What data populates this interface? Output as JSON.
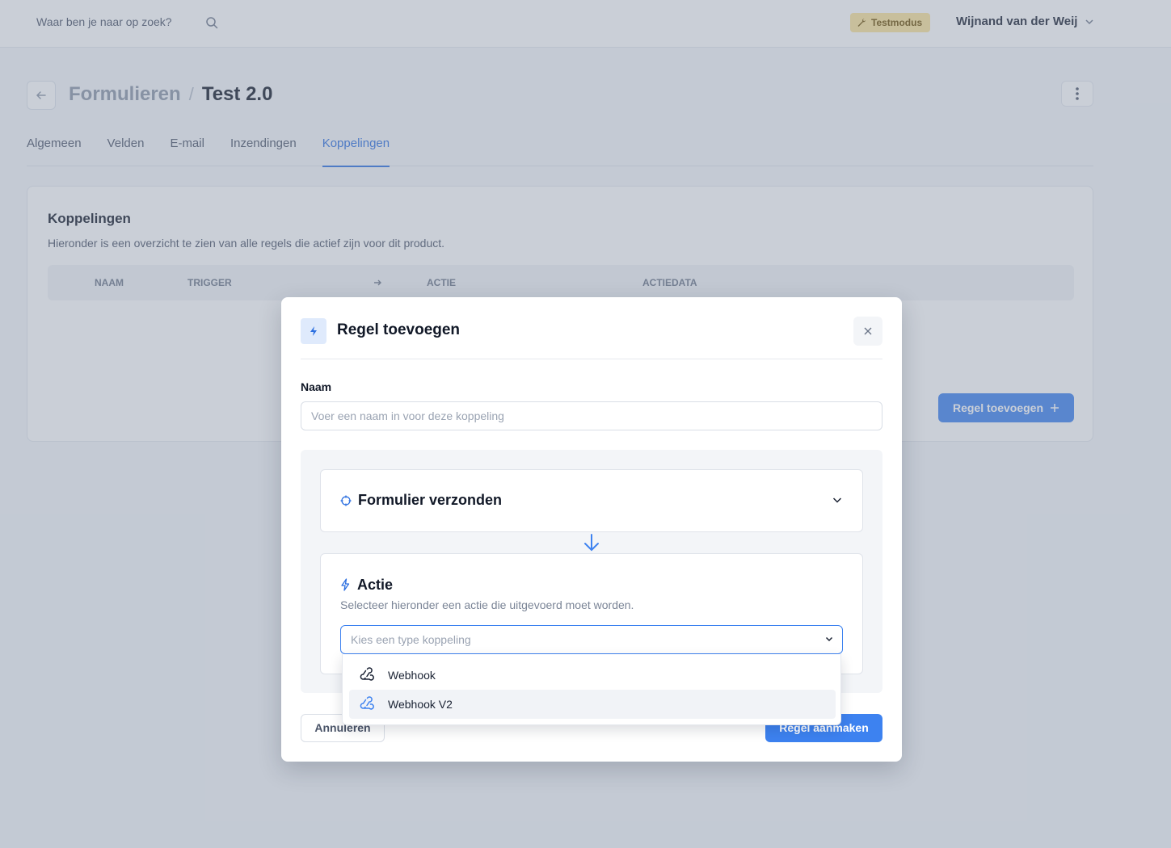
{
  "topbar": {
    "search_placeholder": "Waar ben je naar op zoek?",
    "badge": "Testmodus",
    "user_name": "Wijnand van der Weij"
  },
  "header": {
    "breadcrumb_parent": "Formulieren",
    "breadcrumb_sep": "/",
    "breadcrumb_current": "Test 2.0"
  },
  "tabs": [
    "Algemeen",
    "Velden",
    "E-mail",
    "Inzendingen",
    "Koppelingen"
  ],
  "active_tab": "Koppelingen",
  "card": {
    "title": "Koppelingen",
    "description": "Hieronder is een overzicht te zien van alle regels die actief zijn voor dit product.",
    "columns": [
      "NAAM",
      "TRIGGER",
      "ACTIE",
      "ACTIEDATA"
    ],
    "add_button": "Regel toevoegen"
  },
  "modal": {
    "title": "Regel toevoegen",
    "name_label": "Naam",
    "name_placeholder": "Voer een naam in voor deze koppeling",
    "trigger_title": "Formulier verzonden",
    "action_title": "Actie",
    "action_description": "Selecteer hieronder een actie die uitgevoerd moet worden.",
    "select_placeholder": "Kies een type koppeling",
    "cancel_button": "Annuleren",
    "create_button": "Regel aanmaken"
  },
  "dropdown": {
    "options": [
      "Webhook",
      "Webhook V2"
    ],
    "highlighted": "Webhook V2"
  },
  "colors": {
    "accent": "#3d82f0",
    "badge_bg": "#fbe39a",
    "overlay": "rgba(128,140,160,0.42)"
  }
}
